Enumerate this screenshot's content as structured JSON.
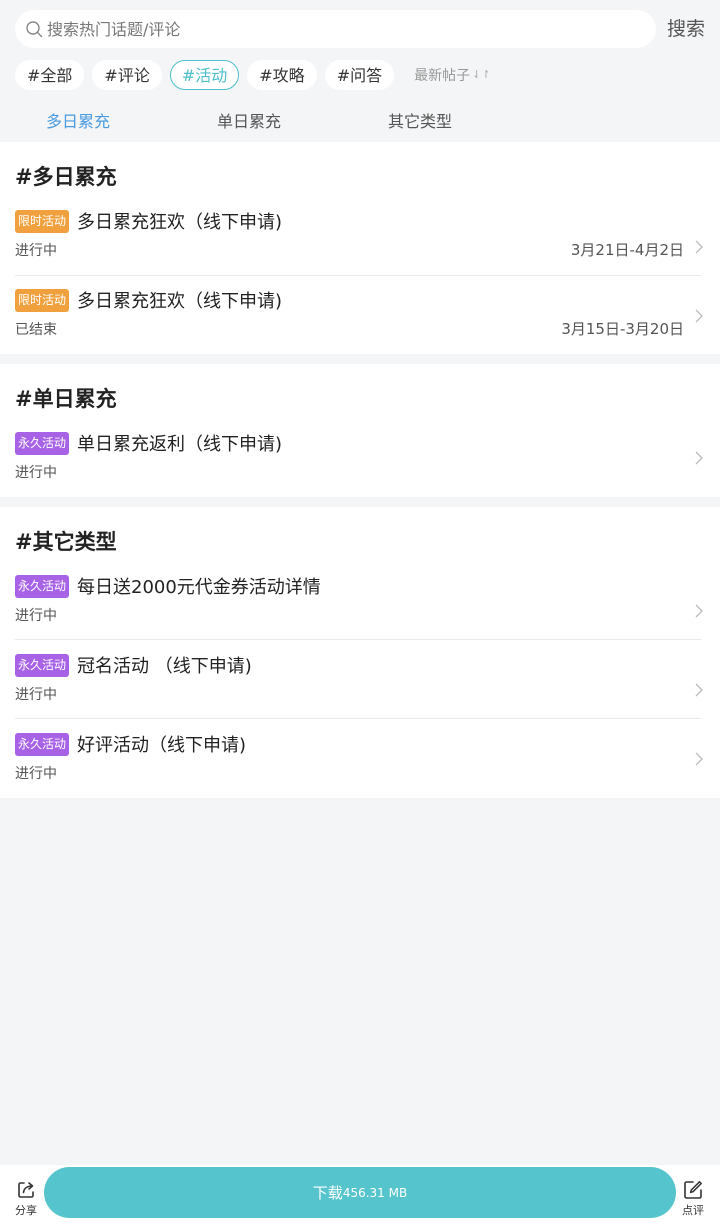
{
  "search": {
    "placeholder": "搜索热门话题/评论",
    "button_label": "搜索"
  },
  "tags": [
    "#全部",
    "#评论",
    "#活动",
    "#攻略",
    "#问答"
  ],
  "active_tag": "#活动",
  "sort": {
    "label": "最新帖子",
    "icon": "sort-arrows-icon"
  },
  "category_tabs": [
    "多日累充",
    "单日累充",
    "其它类型"
  ],
  "active_category": "多日累充",
  "sections": [
    {
      "title": "#多日累充",
      "items": [
        {
          "badge": "限时活动",
          "badge_type": "limited",
          "title": "多日累充狂欢（线下申请)",
          "status": "进行中",
          "date": "3月21日-4月2日"
        },
        {
          "badge": "限时活动",
          "badge_type": "limited",
          "title": "多日累充狂欢（线下申请)",
          "status": "已结束",
          "date": "3月15日-3月20日"
        }
      ]
    },
    {
      "title": "#单日累充",
      "items": [
        {
          "badge": "永久活动",
          "badge_type": "permanent",
          "title": "单日累充返利（线下申请)",
          "status": "进行中",
          "date": ""
        }
      ]
    },
    {
      "title": "#其它类型",
      "items": [
        {
          "badge": "永久活动",
          "badge_type": "permanent",
          "title": "每日送2000元代金券活动详情",
          "status": "进行中",
          "date": ""
        },
        {
          "badge": "永久活动",
          "badge_type": "permanent",
          "title": "冠名活动 （线下申请)",
          "status": "进行中",
          "date": ""
        },
        {
          "badge": "永久活动",
          "badge_type": "permanent",
          "title": "好评活动（线下申请)",
          "status": "进行中",
          "date": ""
        }
      ]
    }
  ],
  "bottom_bar": {
    "share_label": "分享",
    "download_label": "下载",
    "download_size": "456.31 MB",
    "review_label": "点评"
  },
  "colors": {
    "accent": "#4ebfc9",
    "tab_active": "#4a9be0",
    "badge_limited": "#f0a03c",
    "badge_permanent": "#a762e6",
    "download_button": "#56c4cc",
    "background": "#f4f5f7"
  }
}
